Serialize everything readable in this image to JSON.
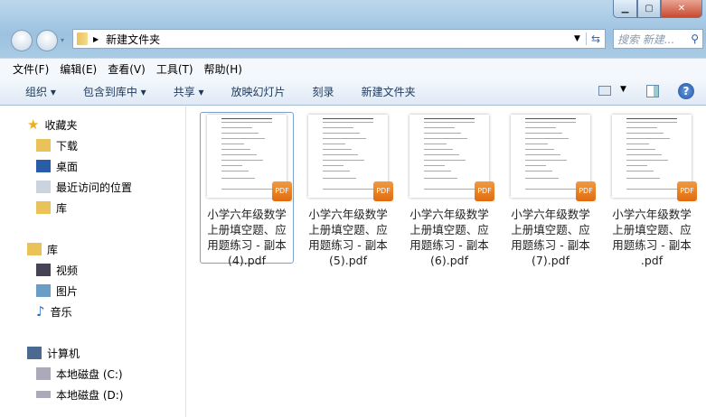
{
  "address": {
    "path": "新建文件夹",
    "search_placeholder": "搜索 新建..."
  },
  "menu": [
    "文件(F)",
    "编辑(E)",
    "查看(V)",
    "工具(T)",
    "帮助(H)"
  ],
  "toolbar": [
    "组织 ▾",
    "包含到库中 ▾",
    "共享 ▾",
    "放映幻灯片",
    "刻录",
    "新建文件夹"
  ],
  "nav": {
    "favorites": {
      "label": "收藏夹",
      "items": [
        "下载",
        "桌面",
        "最近访问的位置",
        "库"
      ]
    },
    "libraries": {
      "label": "库",
      "items": [
        "视频",
        "图片",
        "音乐"
      ]
    },
    "computer": {
      "label": "计算机",
      "items": [
        "本地磁盘 (C:)",
        "本地磁盘 (D:)"
      ]
    }
  },
  "files": [
    {
      "lines": [
        "小学六年级数学",
        "上册填空题、应",
        "用题练习 - 副本",
        "(4).pdf"
      ],
      "badge": "PDF"
    },
    {
      "lines": [
        "小学六年级数学",
        "上册填空题、应",
        "用题练习 - 副本",
        "(5).pdf"
      ],
      "badge": "PDF"
    },
    {
      "lines": [
        "小学六年级数学",
        "上册填空题、应",
        "用题练习 - 副本",
        "(6).pdf"
      ],
      "badge": "PDF"
    },
    {
      "lines": [
        "小学六年级数学",
        "上册填空题、应",
        "用题练习 - 副本",
        "(7).pdf"
      ],
      "badge": "PDF"
    },
    {
      "lines": [
        "小学六年级数学",
        "上册填空题、应",
        "用题练习 - 副本",
        ".pdf"
      ],
      "badge": "PDF"
    }
  ]
}
